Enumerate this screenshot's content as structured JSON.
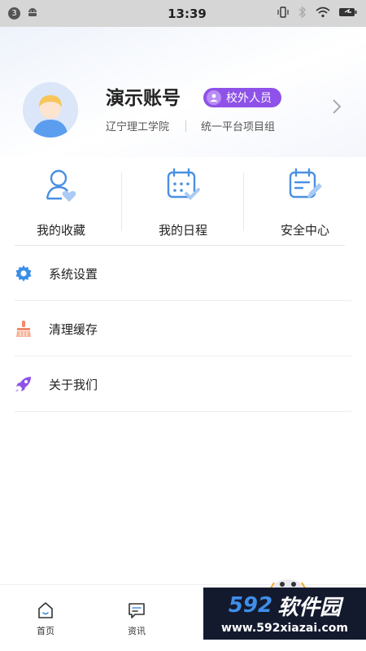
{
  "status_bar": {
    "notification_count": "3",
    "time": "13:39"
  },
  "profile": {
    "name": "演示账号",
    "badge": "校外人员",
    "school": "辽宁理工学院",
    "department": "统一平台项目组"
  },
  "quick_actions": [
    {
      "label": "我的收藏",
      "icon": "user-favorite-icon"
    },
    {
      "label": "我的日程",
      "icon": "calendar-check-icon"
    },
    {
      "label": "安全中心",
      "icon": "calendar-edit-icon"
    }
  ],
  "menu": [
    {
      "label": "系统设置",
      "icon": "gear-icon"
    },
    {
      "label": "清理缓存",
      "icon": "broom-icon"
    },
    {
      "label": "关于我们",
      "icon": "rocket-icon"
    }
  ],
  "bottom_nav": [
    {
      "label": "首页",
      "icon": "home-icon"
    },
    {
      "label": "资讯",
      "icon": "message-icon"
    }
  ],
  "watermark": {
    "brand_num": "592",
    "brand_cn": "软件园",
    "url": "www.592xiazai.com"
  },
  "colors": {
    "accent_blue": "#4a90e2",
    "badge_purple": "#8e52e8"
  }
}
